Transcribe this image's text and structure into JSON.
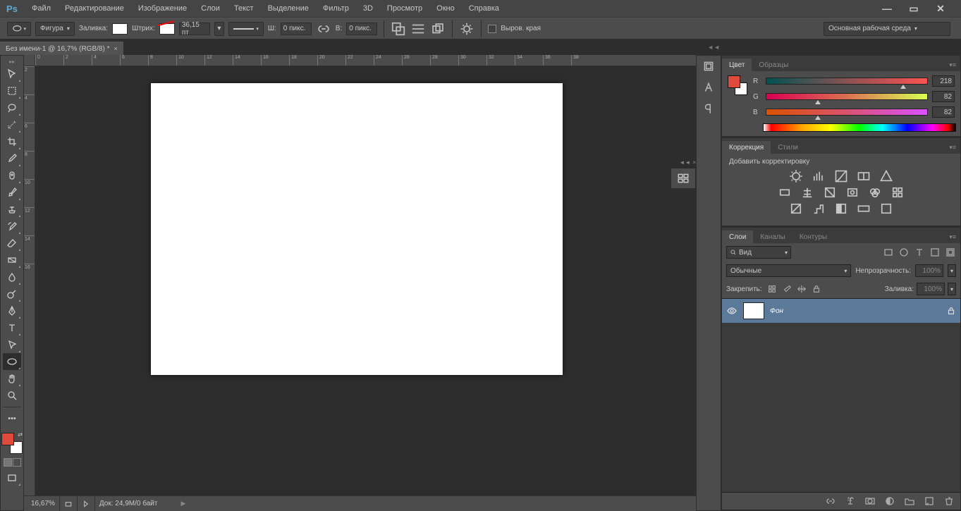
{
  "app": {
    "logo": "Ps"
  },
  "menubar": {
    "items": [
      "Файл",
      "Редактирование",
      "Изображение",
      "Слои",
      "Текст",
      "Выделение",
      "Фильтр",
      "3D",
      "Просмотр",
      "Окно",
      "Справка"
    ]
  },
  "options": {
    "mode_label": "Фигура",
    "fill_label": "Заливка:",
    "stroke_label": "Штрих:",
    "stroke_size": "36,15 пт",
    "w_label": "Ш:",
    "w_value": "0 пикс.",
    "h_label": "В:",
    "h_value": "0 пикс.",
    "align_edges_label": "Выров. края",
    "workspace_label": "Основная рабочая среда"
  },
  "doc_tab": {
    "title": "Без имени-1 @ 16,7% (RGB/8) *"
  },
  "ruler_h": [
    "0",
    "2",
    "4",
    "6",
    "8",
    "10",
    "12",
    "14",
    "16",
    "18",
    "20",
    "22",
    "24",
    "26",
    "28",
    "30",
    "32",
    "34",
    "36",
    "38"
  ],
  "ruler_v": [
    "2",
    "4",
    "6",
    "8",
    "10",
    "12",
    "14",
    "16"
  ],
  "status": {
    "zoom": "16,67%",
    "doc_info": "Док: 24,9M/0 байт"
  },
  "color_panel": {
    "tab_color": "Цвет",
    "tab_swatches": "Образцы",
    "r_label": "R",
    "r_value": "218",
    "g_label": "G",
    "g_value": "82",
    "b_label": "B",
    "b_value": "82"
  },
  "adjust_panel": {
    "tab_adjust": "Коррекция",
    "tab_styles": "Стили",
    "title": "Добавить корректировку"
  },
  "layers_panel": {
    "tab_layers": "Слои",
    "tab_channels": "Каналы",
    "tab_paths": "Контуры",
    "search_label": "Вид",
    "blend_label": "Обычные",
    "opacity_label": "Непрозрачность:",
    "opacity_value": "100%",
    "lock_label": "Закрепить:",
    "fill_label": "Заливка:",
    "fill_value": "100%",
    "layer_name": "Фон"
  },
  "colors": {
    "foreground": "#e04a3c",
    "background": "#ffffff"
  }
}
